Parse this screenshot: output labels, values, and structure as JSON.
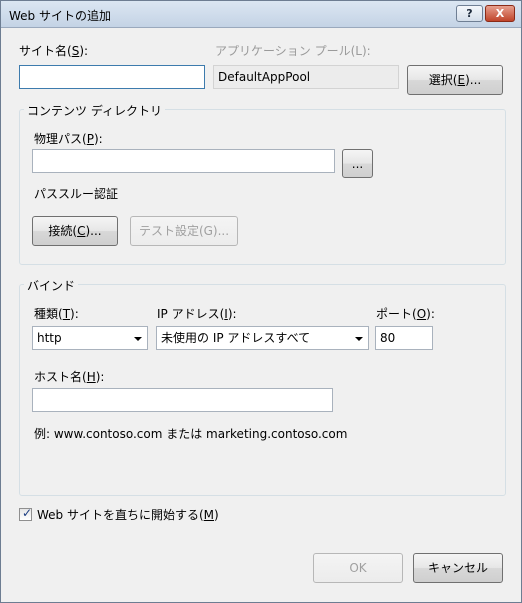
{
  "window": {
    "title": "Web サイトの追加",
    "help_label": "?",
    "close_label": "X"
  },
  "site": {
    "name_label": "サイト名(",
    "name_key": "S",
    "name_suffix": "):",
    "name_value": "",
    "apppool_label": "アプリケーション プール(L):",
    "apppool_value": "DefaultAppPool",
    "select_label": "選択(",
    "select_key": "E",
    "select_suffix": ")..."
  },
  "content": {
    "group_label": "コンテンツ ディレクトリ",
    "path_label": "物理パス(",
    "path_key": "P",
    "path_suffix": "):",
    "path_value": "",
    "browse_label": "...",
    "passthrough_label": "パススルー認証",
    "connect_label": "接続(",
    "connect_key": "C",
    "connect_suffix": ")...",
    "test_label": "テスト設定(G)..."
  },
  "binding": {
    "group_label": "バインド",
    "type_label": "種類(",
    "type_key": "T",
    "type_suffix": "):",
    "type_value": "http",
    "ip_label": "IP アドレス(",
    "ip_key": "I",
    "ip_suffix": "):",
    "ip_value": "未使用の IP アドレスすべて",
    "port_label": "ポート(",
    "port_key": "O",
    "port_suffix": "):",
    "port_value": "80",
    "host_label": "ホスト名(",
    "host_key": "H",
    "host_suffix": "):",
    "host_value": "",
    "example": "例: www.contoso.com または marketing.contoso.com"
  },
  "start": {
    "label": "Web サイトを直ちに開始する(",
    "key": "M",
    "suffix": ")",
    "checked": true
  },
  "footer": {
    "ok_label": "OK",
    "cancel_label": "キャンセル"
  }
}
